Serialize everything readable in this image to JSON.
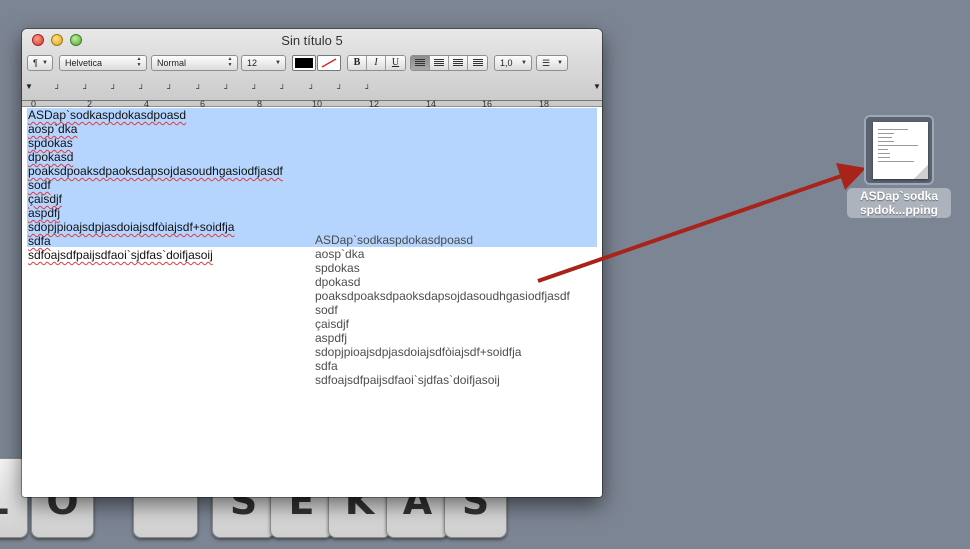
{
  "keyboard": {
    "keys": [
      "L",
      "O",
      "",
      "S",
      "E",
      "K",
      "A",
      "S"
    ]
  },
  "window": {
    "title": "Sin título 5"
  },
  "toolbar": {
    "paragraph_button": "¶",
    "font_family": "Helvetica",
    "font_style": "Normal",
    "font_size": "12",
    "text_color": "#000000",
    "bold": "B",
    "italic": "I",
    "underline": "U",
    "line_spacing": "1,0",
    "list_button": "☰",
    "select_arrows": "▲▼",
    "dropdown_arrow": "▼"
  },
  "ruler": {
    "numbers": [
      "0",
      "2",
      "4",
      "6",
      "8",
      "10",
      "12",
      "14",
      "16",
      "18"
    ]
  },
  "document": {
    "lines": [
      "ASDap`sodkaspdokasdpoasd",
      "aosp`dka",
      "spdokas",
      "dpokasd",
      "poaksdpoaksdpaoksdapsojdasoudhgasiodfjasdf",
      "sodf",
      "çaisdjf",
      "aspdfj",
      "sdopjpioajsdpjasdoiajsdfòiajsdf+soidfja",
      "sdfa",
      "sdfoajsdfpaijsdfaoi`sjdfas`doifjasoij"
    ],
    "selected_line_count": 10
  },
  "desktop_clipping": {
    "label_line1": "ASDap`sodka",
    "label_line2": "spdok...pping",
    "icon": "text-clipping-icon"
  },
  "colors": {
    "desktop": "#7c8593",
    "selection": "#b5d5fe",
    "arrow": "#a8231a"
  }
}
